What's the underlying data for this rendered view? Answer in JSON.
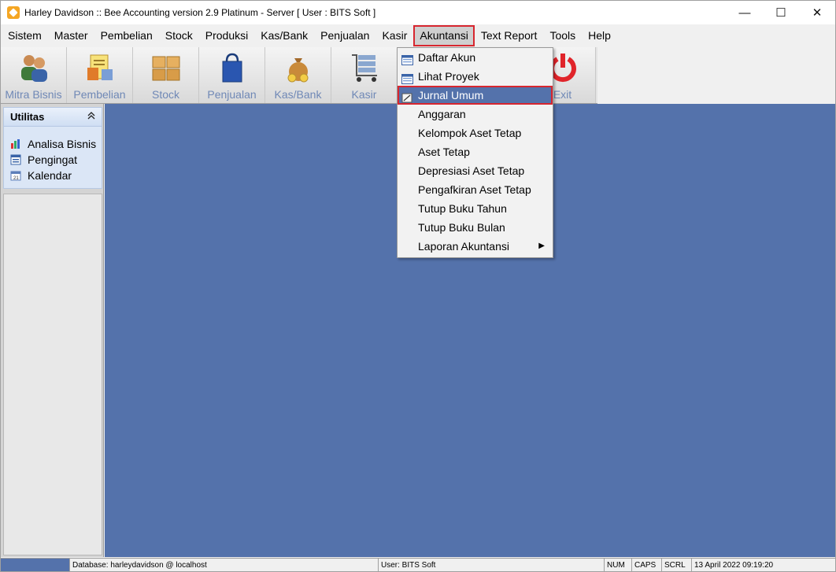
{
  "window": {
    "title": "Harley Davidson :: Bee Accounting version 2.9 Platinum - Server  [ User : BITS Soft ]",
    "controls": {
      "minimize": "—",
      "maximize": "☐",
      "close": "✕"
    }
  },
  "menubar": {
    "items": [
      {
        "label": "Sistem",
        "active": false
      },
      {
        "label": "Master",
        "active": false
      },
      {
        "label": "Pembelian",
        "active": false
      },
      {
        "label": "Stock",
        "active": false
      },
      {
        "label": "Produksi",
        "active": false
      },
      {
        "label": "Kas/Bank",
        "active": false
      },
      {
        "label": "Penjualan",
        "active": false
      },
      {
        "label": "Kasir",
        "active": false
      },
      {
        "label": "Akuntansi",
        "active": true
      },
      {
        "label": "Text Report",
        "active": false
      },
      {
        "label": "Tools",
        "active": false
      },
      {
        "label": "Help",
        "active": false
      }
    ]
  },
  "toolbar": {
    "buttons": [
      {
        "label": "Mitra Bisnis",
        "icon": "people-icon"
      },
      {
        "label": "Pembelian",
        "icon": "purchase-icon"
      },
      {
        "label": "Stock",
        "icon": "boxes-icon"
      },
      {
        "label": "Penjualan",
        "icon": "shopping-bag-icon"
      },
      {
        "label": "Kas/Bank",
        "icon": "money-bag-icon"
      },
      {
        "label": "Kasir",
        "icon": "cart-icon"
      },
      {
        "label": "",
        "icon": "hidden"
      },
      {
        "label": "",
        "icon": "hidden"
      },
      {
        "label": "Exit",
        "icon": "power-icon"
      }
    ]
  },
  "sidebar": {
    "title": "Utilitas",
    "collapse_glyph": "≈",
    "items": [
      {
        "label": "Analisa Bisnis",
        "icon": "chart-icon"
      },
      {
        "label": "Pengingat",
        "icon": "reminder-icon"
      },
      {
        "label": "Kalendar",
        "icon": "calendar-icon"
      }
    ]
  },
  "dropdown": {
    "items": [
      {
        "label": "Daftar Akun",
        "icon": "list-icon",
        "highlight": false,
        "submenu": false
      },
      {
        "label": "Lihat Proyek",
        "icon": "list-icon",
        "highlight": false,
        "submenu": false
      },
      {
        "label": "Jurnal Umum",
        "icon": "journal-icon",
        "highlight": true,
        "submenu": false
      },
      {
        "label": "Anggaran",
        "icon": "",
        "highlight": false,
        "submenu": false
      },
      {
        "label": "Kelompok Aset Tetap",
        "icon": "",
        "highlight": false,
        "submenu": false
      },
      {
        "label": "Aset Tetap",
        "icon": "",
        "highlight": false,
        "submenu": false
      },
      {
        "label": "Depresiasi Aset Tetap",
        "icon": "",
        "highlight": false,
        "submenu": false
      },
      {
        "label": "Pengafkiran Aset Tetap",
        "icon": "",
        "highlight": false,
        "submenu": false
      },
      {
        "label": "Tutup Buku Tahun",
        "icon": "",
        "highlight": false,
        "submenu": false
      },
      {
        "label": "Tutup Buku Bulan",
        "icon": "",
        "highlight": false,
        "submenu": false
      },
      {
        "label": "Laporan Akuntansi",
        "icon": "",
        "highlight": false,
        "submenu": true
      }
    ]
  },
  "statusbar": {
    "database": "Database: harleydavidson @ localhost",
    "user": "User: BITS Soft",
    "num": "NUM",
    "caps": "CAPS",
    "scrl": "SCRL",
    "datetime": "13 April 2022  09:19:20"
  },
  "colors": {
    "workspace": "#5472ab",
    "highlight_outline": "#d7262f",
    "toolbar_label": "#6f88b6"
  }
}
